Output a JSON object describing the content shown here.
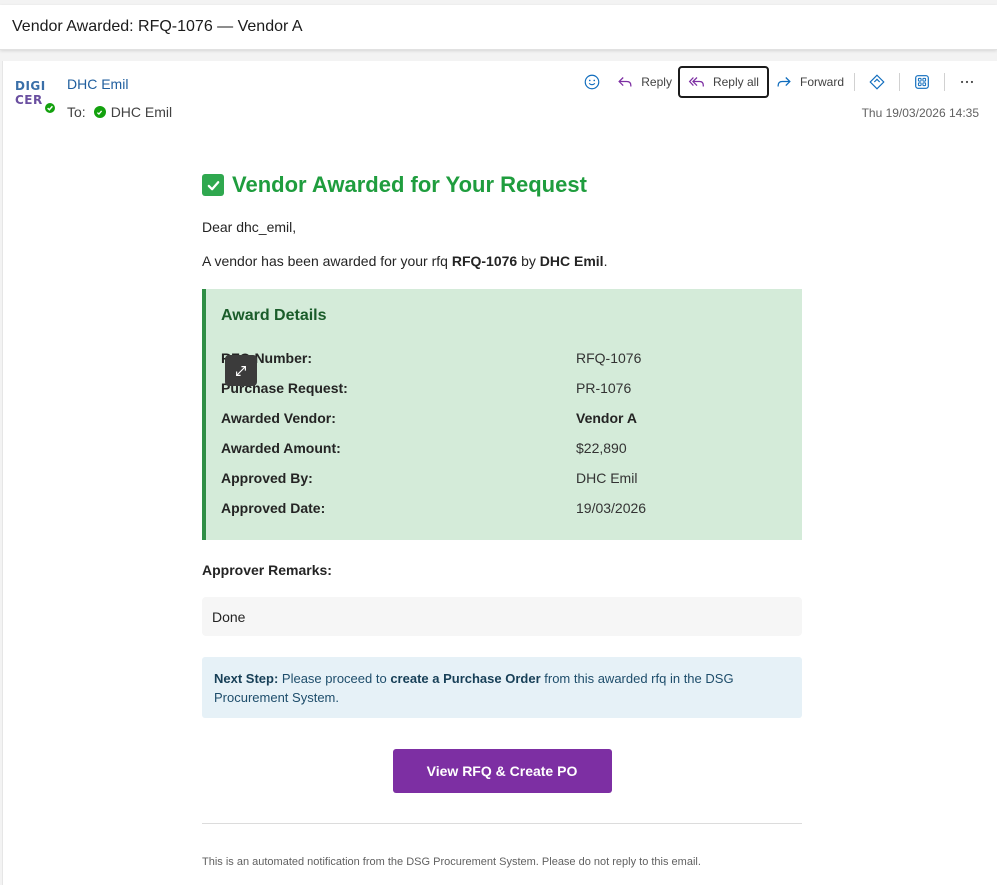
{
  "subject": "Vendor Awarded: RFQ-1076 — Vendor A",
  "sender": {
    "avatar_line1": "DIGI",
    "avatar_line2": "CER",
    "name": "DHC Emil",
    "to_label": "To:",
    "to_name": "DHC Emil",
    "timestamp": "Thu 19/03/2026 14:35"
  },
  "actions": {
    "reply": "Reply",
    "reply_all": "Reply all",
    "forward": "Forward"
  },
  "email": {
    "headline": "Vendor Awarded for Your Request",
    "greeting": "Dear dhc_emil,",
    "intro_pre": "A vendor has been awarded for your rfq ",
    "intro_rfq": "RFQ-1076",
    "intro_mid": " by ",
    "intro_by": "DHC Emil",
    "intro_end": ".",
    "award_title": "Award Details",
    "award_rows": [
      {
        "label": "RFQ Number:",
        "value": "RFQ-1076"
      },
      {
        "label": "Purchase Request:",
        "value": "PR-1076"
      },
      {
        "label": "Awarded Vendor:",
        "value": "Vendor A"
      },
      {
        "label": "Awarded Amount:",
        "value": "$22,890"
      },
      {
        "label": "Approved By:",
        "value": "DHC Emil"
      },
      {
        "label": "Approved Date:",
        "value": "19/03/2026"
      }
    ],
    "remarks_label": "Approver Remarks:",
    "remarks_value": "Done",
    "next_step_label": "Next Step:",
    "next_step_pre": " Please proceed to ",
    "next_step_bold": "create a Purchase Order",
    "next_step_post": " from this awarded rfq in the DSG Procurement System.",
    "cta": "View RFQ & Create PO",
    "footer": "This is an automated notification from the DSG Procurement System. Please do not reply to this email."
  },
  "colors": {
    "headline": "#1f9d3e",
    "award_bg": "#d4ebd9",
    "award_border": "#2f8e46",
    "cta_bg": "#7d2fa3",
    "next_bg": "#e6f1f7"
  }
}
